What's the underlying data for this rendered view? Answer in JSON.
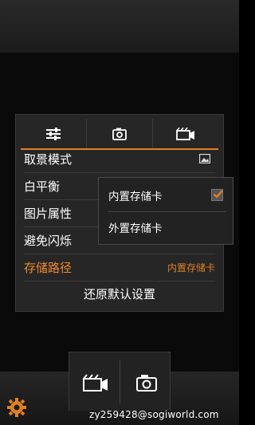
{
  "settings_panel": {
    "rows": [
      {
        "label": "取景模式",
        "value": ""
      },
      {
        "label": "白平衡",
        "value": ""
      },
      {
        "label": "图片属性",
        "value": ""
      },
      {
        "label": "避免闪烁",
        "value": ""
      },
      {
        "label": "存储路径",
        "value": "内置存储卡"
      }
    ],
    "reset_label": "还原默认设置"
  },
  "storage_menu": {
    "options": [
      "内置存储卡",
      "外置存储卡"
    ],
    "selected": "内置存储卡"
  },
  "watermark": "zy259428@sogiworld.com",
  "accent_color": "#e08020",
  "icons": [
    "sliders-icon",
    "camera-icon",
    "video-camera-icon",
    "scene-image-icon",
    "settings-gear-icon",
    "checkbox-checked-icon"
  ]
}
